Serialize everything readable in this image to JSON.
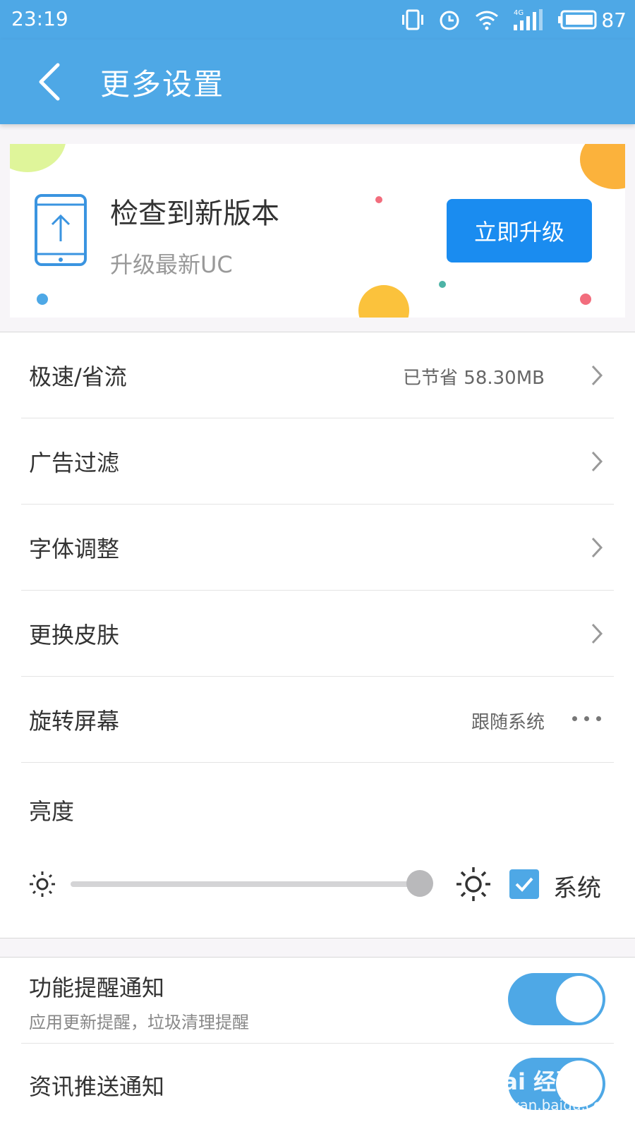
{
  "status_bar": {
    "time": "23:19",
    "network": "4G",
    "battery": "87",
    "icons": [
      "vibrate-icon",
      "alarm-icon",
      "wifi-icon",
      "signal-icon",
      "battery-icon"
    ]
  },
  "app_bar": {
    "title": "更多设置",
    "back_icon": "back-arrow-icon",
    "background_color": "#4ea8e6"
  },
  "update_banner": {
    "icon": "phone-upgrade-icon",
    "headline": "检查到新版本",
    "subtitle": "升级最新UC",
    "button_label": "立即升级",
    "button_color": "#1a8cf0"
  },
  "settings": [
    {
      "label": "极速/省流",
      "value": "已节省 58.30MB",
      "trailing": "chevron-right-icon"
    },
    {
      "label": "广告过滤",
      "value": "",
      "trailing": "chevron-right-icon"
    },
    {
      "label": "字体调整",
      "value": "",
      "trailing": "chevron-right-icon"
    },
    {
      "label": "更换皮肤",
      "value": "",
      "trailing": "chevron-right-icon"
    },
    {
      "label": "旋转屏幕",
      "value": "跟随系统",
      "trailing": "more-dots-icon"
    }
  ],
  "brightness": {
    "label": "亮度",
    "slider_level": 1.0,
    "system_checked": true,
    "system_label": "系统"
  },
  "notifications": [
    {
      "label": "功能提醒通知",
      "description": "应用更新提醒，垃圾清理提醒",
      "enabled": true
    },
    {
      "label": "资讯推送通知",
      "description": "",
      "enabled": true
    }
  ],
  "watermark": {
    "brand": "Bai 经验",
    "url": "jingyan.baidu.com"
  }
}
